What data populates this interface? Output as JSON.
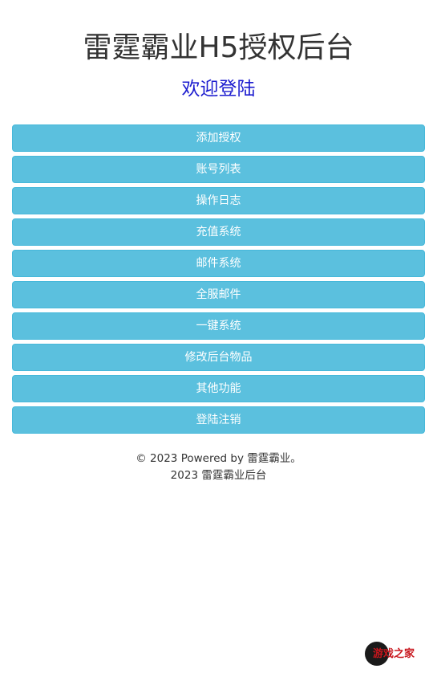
{
  "header": {
    "title": "雷霆霸业H5授权后台",
    "subtitle": "欢迎登陆"
  },
  "menu": {
    "items": [
      {
        "label": "添加授权"
      },
      {
        "label": "账号列表"
      },
      {
        "label": "操作日志"
      },
      {
        "label": "充值系统"
      },
      {
        "label": "邮件系统"
      },
      {
        "label": "全服邮件"
      },
      {
        "label": "一键系统"
      },
      {
        "label": "修改后台物品"
      },
      {
        "label": "其他功能"
      },
      {
        "label": "登陆注销"
      }
    ]
  },
  "footer": {
    "line1": "© 2023 Powered by 雷霆霸业。",
    "line2": "2023 雷霆霸业后台"
  },
  "watermark": {
    "text": "游戏之家"
  },
  "colors": {
    "button_bg": "#5bc0de",
    "button_border": "#46b8da",
    "subtitle": "#1c1ccf",
    "title": "#333333"
  }
}
